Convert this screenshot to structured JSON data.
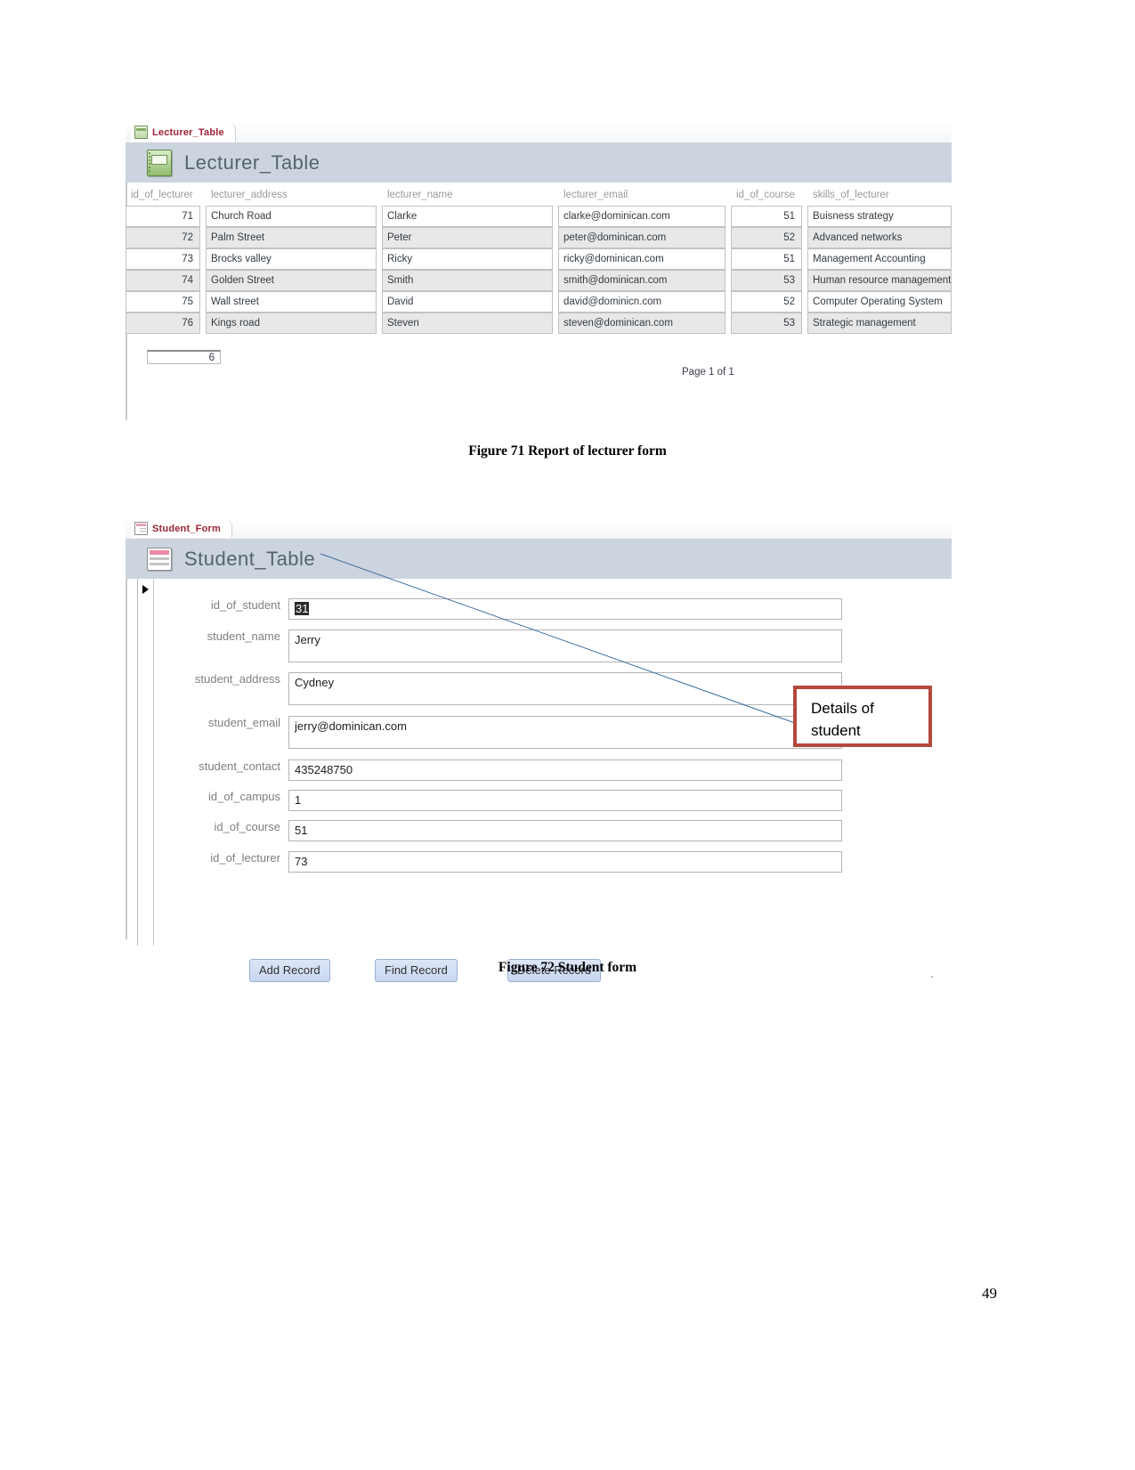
{
  "document": {
    "page_number": "49",
    "captions": {
      "figure_71": "Figure 71 Report of lecturer form",
      "figure_72": "Figure 72 Student form"
    }
  },
  "report": {
    "tab": {
      "label": "Lecturer_Table",
      "icon": "table-icon"
    },
    "title": "Lecturer_Table",
    "title_icon": "table-icon",
    "columns": [
      "id_of_lecturer",
      "lecturer_address",
      "lecturer_name",
      "lecturer_email",
      "id_of_course",
      "skills_of_lecturer"
    ],
    "rows": [
      [
        "71",
        "Church Road",
        "Clarke",
        "clarke@dominican.com",
        "51",
        "Buisness strategy"
      ],
      [
        "72",
        "Palm Street",
        "Peter",
        "peter@dominican.com",
        "52",
        "Advanced networks"
      ],
      [
        "73",
        "Brocks valley",
        "Ricky",
        "ricky@dominican.com",
        "51",
        "Management Accounting"
      ],
      [
        "74",
        "Golden Street",
        "Smith",
        "smith@dominican.com",
        "53",
        "Human resource management"
      ],
      [
        "75",
        "Wall street",
        "David",
        "david@dominicn.com",
        "52",
        "Computer Operating System"
      ],
      [
        "76",
        "Kings road",
        "Steven",
        "steven@dominican.com",
        "53",
        "Strategic management"
      ]
    ],
    "record_count": "6",
    "page_indicator": "Page 1 of 1"
  },
  "student_form": {
    "tab": {
      "label": "Student_Form",
      "icon": "form-icon"
    },
    "title": "Student_Table",
    "title_icon": "form-icon",
    "fields": [
      {
        "label": "id_of_student",
        "value": "31",
        "selected": true
      },
      {
        "label": "student_name",
        "value": "Jerry",
        "selected": false
      },
      {
        "label": "student_address",
        "value": "Cydney",
        "selected": false
      },
      {
        "label": "student_email",
        "value": "jerry@dominican.com",
        "selected": false
      },
      {
        "label": "student_contact",
        "value": "435248750",
        "selected": false
      },
      {
        "label": "id_of_campus",
        "value": "1",
        "selected": false
      },
      {
        "label": "id_of_course",
        "value": "51",
        "selected": false
      },
      {
        "label": "id_of_lecturer",
        "value": "73",
        "selected": false
      }
    ],
    "buttons": [
      {
        "label": "Add Record"
      },
      {
        "label": "Find Record"
      },
      {
        "label": "Delete Record"
      }
    ],
    "trailing_dot": "."
  },
  "annotation": {
    "callout_line1": "Details of",
    "callout_line2": "student",
    "border_color": "#b4483c",
    "leader_color": "#3c6e9e"
  }
}
